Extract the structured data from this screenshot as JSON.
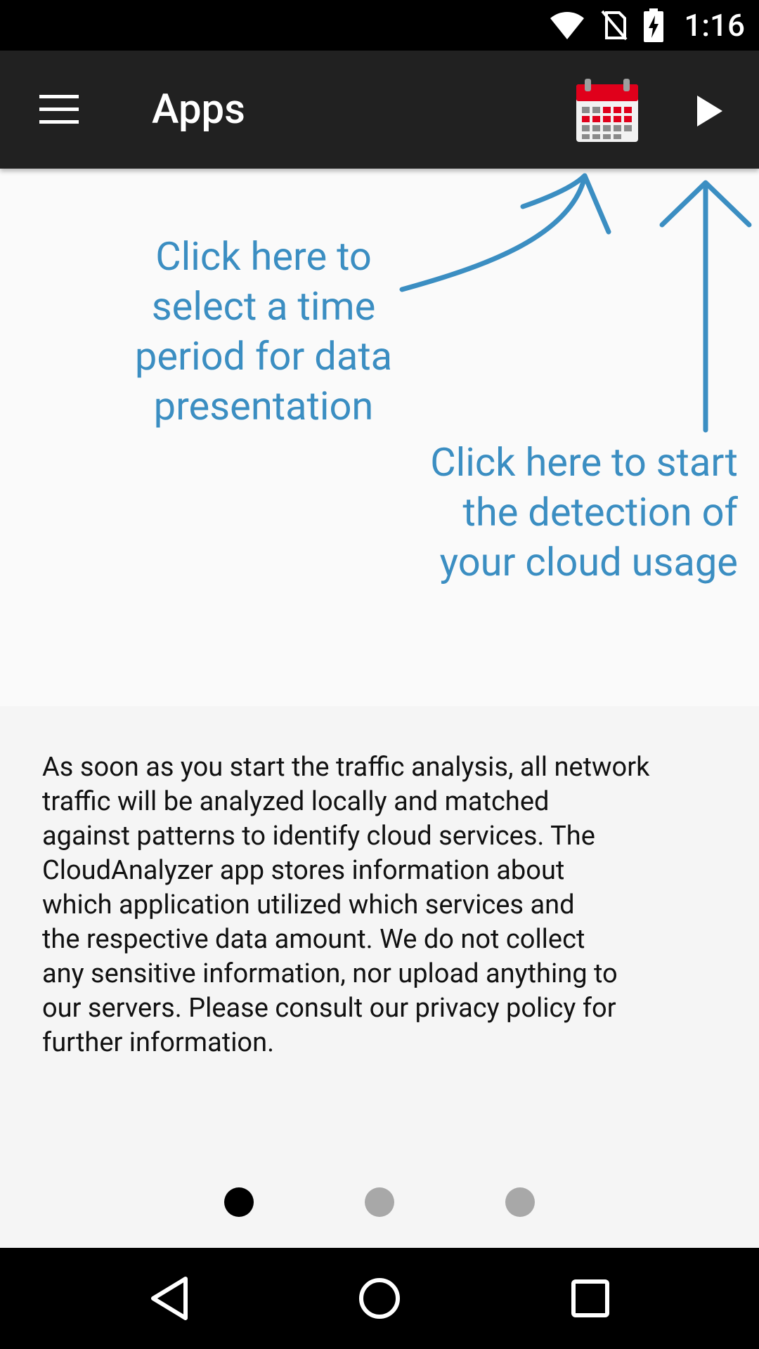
{
  "status_bar": {
    "time": "1:16",
    "icons": [
      "wifi-icon",
      "no-sim-icon",
      "battery-charging-icon"
    ]
  },
  "toolbar": {
    "title": "Apps",
    "menu_icon": "hamburger-menu-icon",
    "calendar_icon": "calendar-icon",
    "play_icon": "play-icon"
  },
  "callouts": {
    "calendar": [
      "Click here to",
      "select a time",
      "period for data",
      "presentation"
    ],
    "play": [
      "Click here to start",
      "the detection of",
      "your cloud usage"
    ]
  },
  "info": {
    "lines": [
      "As soon as you start the traffic analysis, all network",
      "traffic will be analyzed locally and matched",
      "against patterns to identify cloud services. The",
      "CloudAnalyzer app stores information about",
      "which application utilized which services and",
      "the respective data amount. We do not collect",
      "any sensitive information, nor upload anything to",
      "our servers. Please consult our privacy policy for",
      "further information."
    ]
  },
  "pager": {
    "count": 3,
    "active_index": 0
  },
  "nav_bar": {
    "buttons": [
      "back-icon",
      "home-icon",
      "recents-icon"
    ]
  },
  "colors": {
    "accent": "#3b8ec2",
    "toolbar": "#212121",
    "calendar_red": "#e0001b"
  }
}
